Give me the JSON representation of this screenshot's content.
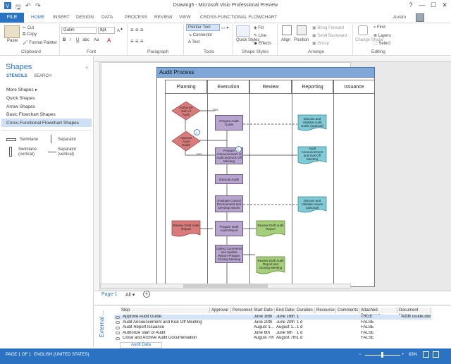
{
  "window": {
    "title": "Drawing5 - Microsoft Visio Professional Preview",
    "user": "Austin",
    "controls": [
      "?",
      "—",
      "☐",
      "✕"
    ]
  },
  "tabs": [
    "FILE",
    "HOME",
    "INSERT",
    "DESIGN",
    "DATA",
    "PROCESS",
    "REVIEW",
    "VIEW",
    "CROSS-FUNCTIONAL FLOWCHART"
  ],
  "ribbon": {
    "clipboard": {
      "paste": "Paste",
      "cut": "Cut",
      "copy": "Copy",
      "format_painter": "Format Painter",
      "label": "Clipboard"
    },
    "font": {
      "name": "Gulim",
      "size": "8pt.",
      "label": "Font"
    },
    "paragraph": {
      "label": "Paragraph"
    },
    "tools": {
      "pointer": "Pointer Tool",
      "connector": "Connector",
      "text": "Text",
      "label": "Tools"
    },
    "shape_styles": {
      "quick_styles": "Quick Styles",
      "fill": "Fill",
      "line": "Line",
      "effects": "Effects",
      "label": "Shape Styles"
    },
    "arrange": {
      "align": "Align",
      "position": "Position",
      "bring_forward": "Bring Forward",
      "send_backward": "Send Backward",
      "group": "Group",
      "label": "Arrange"
    },
    "editing": {
      "change_shape": "Change Shape",
      "find": "Find",
      "layers": "Layers",
      "select": "Select",
      "label": "Editing"
    }
  },
  "shapes_panel": {
    "title": "Shapes",
    "stencils": "STENCILS",
    "search": "SEARCH",
    "items": [
      "More Shapes",
      "Quick Shapes",
      "Arrow Shapes",
      "Basic Flowchart Shapes",
      "Cross-Functional Flowchart Shapes"
    ],
    "masters": [
      "Swimlane",
      "Separator",
      "Swimlane (vertical)",
      "Separator (vertical)"
    ]
  },
  "diagram": {
    "title": "Audit Process",
    "lanes": [
      {
        "name": "Planning",
        "color": "#d97b7b"
      },
      {
        "name": "Execution",
        "color": "#b7a4cf"
      },
      {
        "name": "Review",
        "color": "#a6cf7a"
      },
      {
        "name": "Reporting",
        "color": "#7fcbd8"
      },
      {
        "name": "Issuance",
        "color": "#f2a65a"
      }
    ],
    "shapes": {
      "authorize": "Authorize start of Audit",
      "approve": "Approve Audit Guide",
      "prepare_guide": "Prepare Audit Guide",
      "discuss": "Discuss and Validate Audit Guide (optional)",
      "prepare_announce": "Prepare Announcement of Audit and Kick Off Meeting",
      "audit_announce": "Audit Announcement and Kick Off Meeting",
      "execute": "Execute Audit",
      "evaluate": "Evaluate Control Environment and Develop Issues",
      "discuss_issues": "Discuss and Validate Issues (optional)",
      "review_draft_left": "Review Draft Audit Report",
      "prepare_draft": "Prepare Draft Audit Report",
      "review_draft": "Review Draft Audit Report",
      "collect": "Collect Comments and Update Report Prepare Closing Meeting",
      "review_closing": "Review Draft Audit Report and Closing Meeting",
      "yes": "Yes",
      "no": "No"
    }
  },
  "page_tabs": {
    "page": "Page-1",
    "all": "All",
    "add": "+"
  },
  "data_panel": {
    "side_label": "External ...",
    "columns": [
      "Step",
      "Approval",
      "Personnel",
      "Start Date",
      "End Date",
      "Duration",
      "Resource",
      "Comments",
      "Attached Document",
      "Document Name"
    ],
    "rows": [
      [
        "Approve Audit Guide",
        "",
        "",
        "June 16th",
        "June 16th",
        "1",
        "",
        "",
        "TRUE",
        "Audit Guide.doc"
      ],
      [
        "Audit Announcement and Kick Off Meeting",
        "",
        "",
        "June 20th",
        "June 20th",
        "1 d",
        "",
        "",
        "FALSE",
        ""
      ],
      [
        "Audit Report Issuance",
        "",
        "",
        "August 1...",
        "August 1...",
        "1 d",
        "",
        "",
        "FALSE",
        ""
      ],
      [
        "Authorize start of Audit",
        "",
        "",
        "June 6th",
        "June 6th",
        "1 d",
        "",
        "",
        "FALSE",
        ""
      ],
      [
        "Close and Archive Audit Documentation",
        "",
        "",
        "August 7th",
        "August 7th",
        "1 d",
        "",
        "",
        "FALSE",
        ""
      ]
    ],
    "tab": "Audit Data"
  },
  "status": {
    "page": "PAGE 1 OF 1",
    "lang": "ENGLISH (UNITED STATES)",
    "zoom": "83%"
  }
}
